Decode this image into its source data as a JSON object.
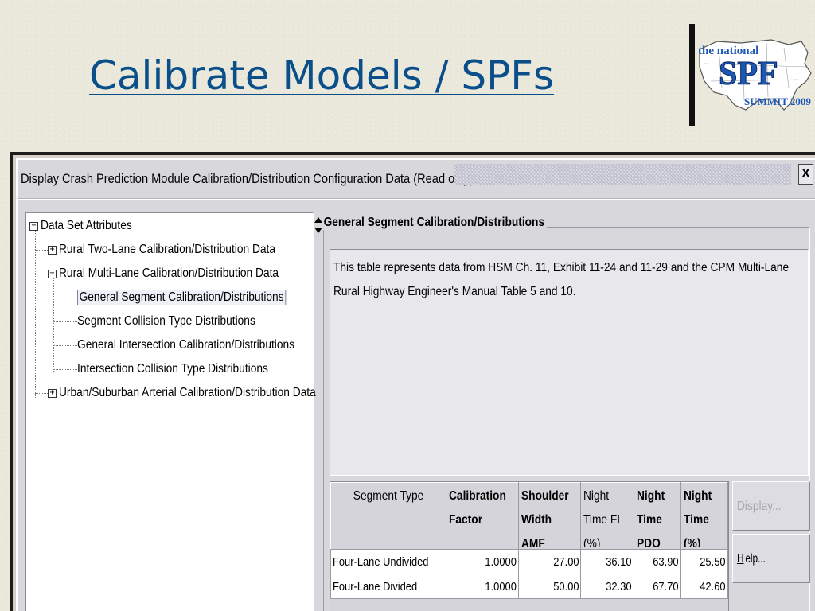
{
  "slide": {
    "title": "Calibrate Models / SPFs"
  },
  "logo": {
    "line1": "the national",
    "line2": "SPF",
    "line3": "SUMMIT 2009"
  },
  "window": {
    "title": "Display Crash Prediction Module Calibration/Distribution Configuration Data (Read only)",
    "close_glyph": "X"
  },
  "tree": {
    "root": "Data Set Attributes",
    "items": [
      {
        "label": "Rural Two-Lane Calibration/Distribution Data",
        "expander": "+"
      },
      {
        "label": "Rural Multi-Lane Calibration/Distribution Data",
        "expander": "−"
      },
      {
        "label": "General Segment Calibration/Distributions",
        "selected": true
      },
      {
        "label": "Segment Collision Type Distributions"
      },
      {
        "label": "General Intersection Calibration/Distributions"
      },
      {
        "label": "Intersection Collision Type Distributions"
      },
      {
        "label": "Urban/Suburban Arterial Calibration/Distribution Data",
        "expander": "+"
      }
    ],
    "root_expander": "−"
  },
  "panel": {
    "group_title": "General Segment Calibration/Distributions",
    "description": "This table represents data from HSM Ch. 11, Exhibit 11-24 and 11-29 and the CPM Multi-Lane Rural Highway Engineer's Manual Table 5 and 10."
  },
  "table": {
    "headers": [
      "Segment Type",
      "Calibration Factor",
      "Shoulder Width AMF Related",
      "Night Time FI (%)",
      "Night Time PDO (%)",
      "Night Time (%)"
    ],
    "rows": [
      [
        "Four-Lane Undivided",
        "1.0000",
        "27.00",
        "36.10",
        "63.90",
        "25.50"
      ],
      [
        "Four-Lane Divided",
        "1.0000",
        "50.00",
        "32.30",
        "67.70",
        "42.60"
      ]
    ]
  },
  "buttons": {
    "display_label": "Display...",
    "help_mnemonic": "H",
    "help_rest": "elp..."
  },
  "colors": {
    "title_blue": "#0b4f8a",
    "window_bg": "#d8d8dc"
  }
}
